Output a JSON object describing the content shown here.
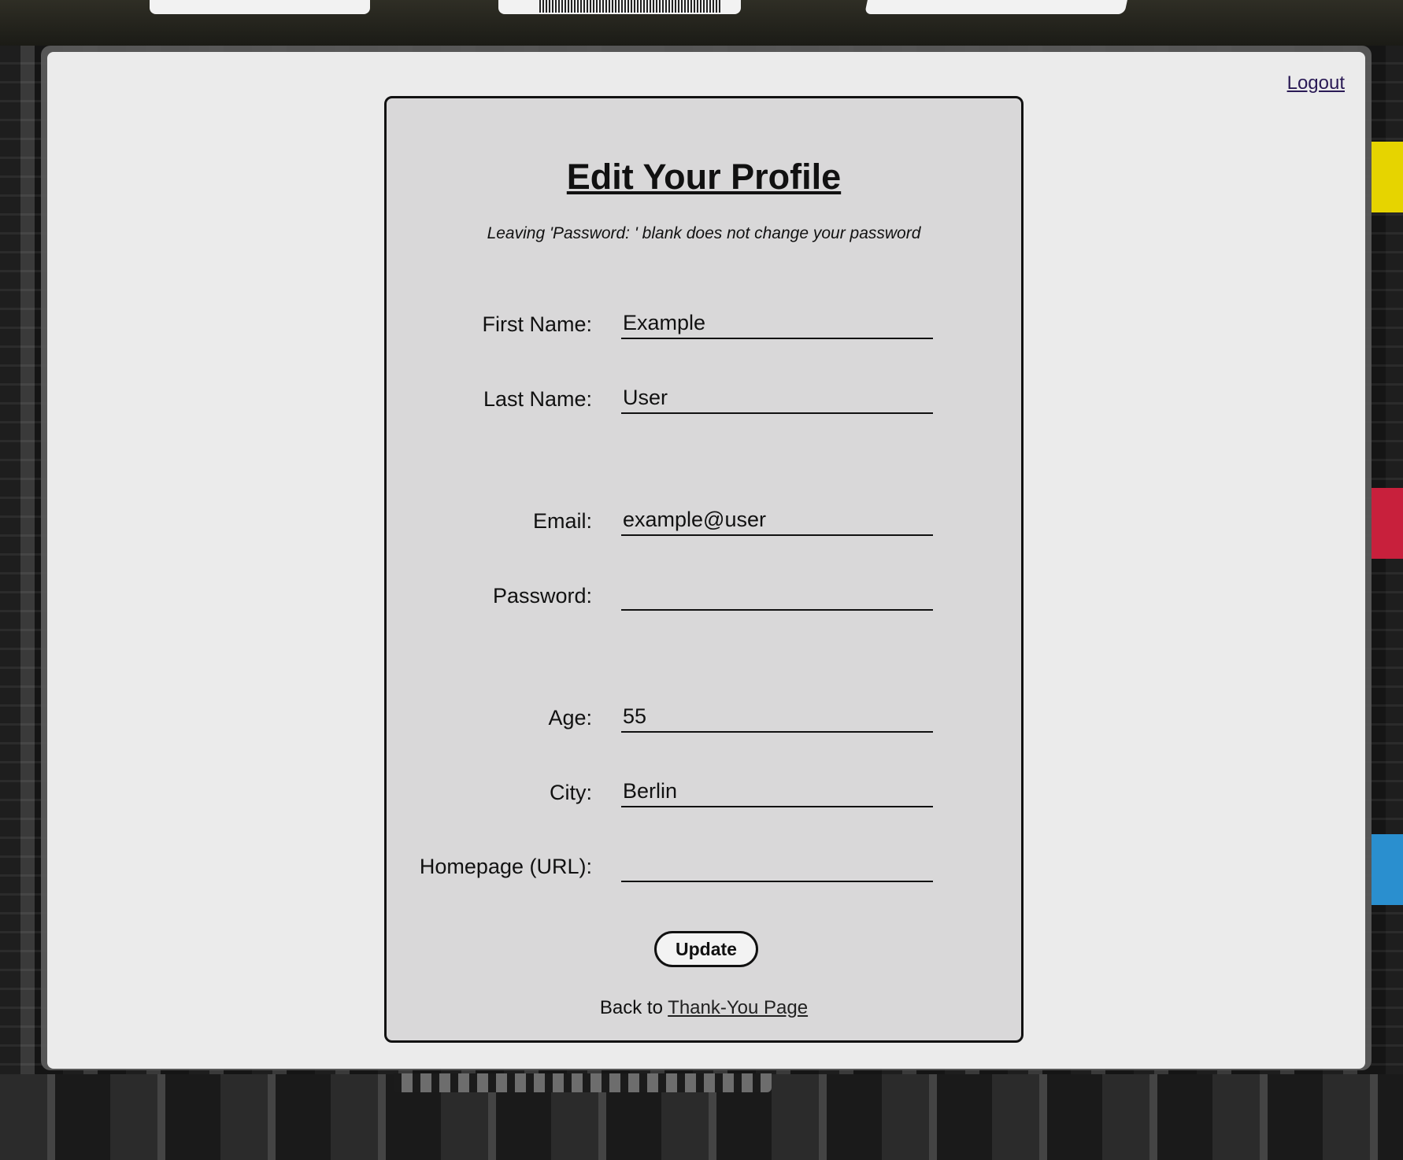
{
  "header": {
    "logout_label": "Logout"
  },
  "form": {
    "title": "Edit Your Profile",
    "note": "Leaving 'Password: ' blank does not change your password",
    "fields": [
      {
        "label": "First Name:",
        "value": "Example"
      },
      {
        "label": "Last Name:",
        "value": "User"
      },
      {
        "label": "Email:",
        "value": "example@user"
      },
      {
        "label": "Password:",
        "value": ""
      },
      {
        "label": "Age:",
        "value": "55"
      },
      {
        "label": "City:",
        "value": "Berlin"
      },
      {
        "label": "Homepage (URL):",
        "value": ""
      }
    ],
    "submit_label": "Update"
  },
  "footer": {
    "back_prefix": "Back to ",
    "back_link_label": "Thank-You Page"
  },
  "colors": {
    "card_background": "#d9d8d9",
    "page_background": "#ebebeb",
    "link_visited": "#2a1a55"
  }
}
